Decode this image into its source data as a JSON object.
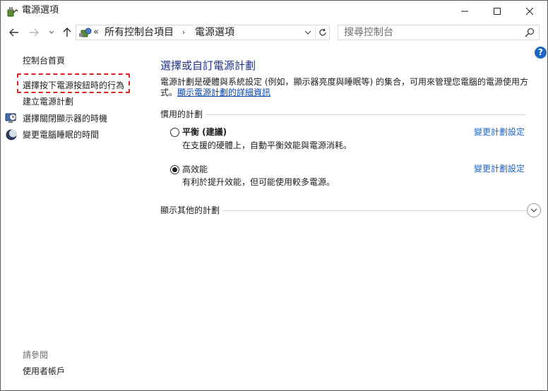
{
  "window": {
    "title": "電源選項",
    "minimize_glyph": "—",
    "maximize_glyph": "☐",
    "close_glyph": "✕"
  },
  "nav": {
    "back_glyph": "←",
    "forward_glyph": "→",
    "recent_glyph": "⌄",
    "up_glyph": "↑"
  },
  "address": {
    "chevron": "«",
    "crumbs": [
      "所有控制台項目",
      "電源選項"
    ],
    "separator": "›"
  },
  "search": {
    "placeholder": "搜尋控制台"
  },
  "help": {
    "label": "?"
  },
  "sidebar": {
    "home": "控制台首頁",
    "items": [
      {
        "label": "選擇按下電源按鈕時的行為",
        "icon": null
      },
      {
        "label": "建立電源計劃",
        "icon": null
      },
      {
        "label": "選擇關閉顯示器的時機",
        "icon": "display-clock-icon"
      },
      {
        "label": "變更電腦睡眠的時間",
        "icon": "moon-icon"
      }
    ],
    "see_also": "請參閱",
    "user_accounts": "使用者帳戶"
  },
  "main": {
    "title": "選擇或自訂電源計劃",
    "desc": "電源計劃是硬體與系統設定 (例如，顯示器亮度與睡眠等) 的集合，可用來管理您電腦的電源使用方式。",
    "desc_link": "顯示電源計劃的詳細資訊",
    "preferred_section": "慣用的計劃",
    "plans": [
      {
        "name": "平衡 (建議)",
        "desc": "在支援的硬體上，自動平衡效能與電源消耗。",
        "change": "變更計劃設定",
        "selected": false
      },
      {
        "name": "高效能",
        "desc": "有利於提升效能，但可能使用較多電源。",
        "change": "變更計劃設定",
        "selected": true
      }
    ],
    "more_section": "顯示其他的計劃"
  },
  "colors": {
    "title_blue": "#1e3287",
    "link_blue": "#1e66c8",
    "highlight_red": "#e02020",
    "help_blue": "#1e67c4"
  }
}
